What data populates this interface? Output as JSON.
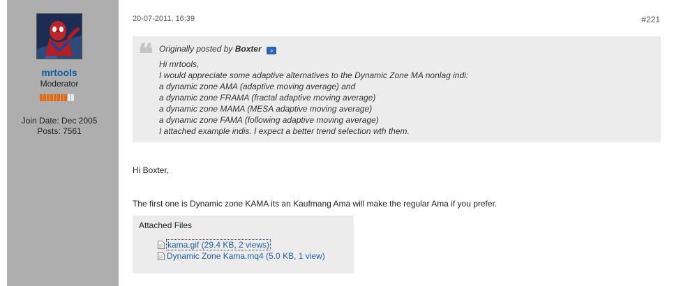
{
  "user": {
    "name": "mrtools",
    "title": "Moderator",
    "join_date": "Join Date: Dec 2005",
    "posts": "Posts: 7561",
    "reputation_level": 8,
    "reputation_max": 10,
    "colors": {
      "username": "#0d5fa8",
      "rep_on": "#e86a10",
      "sidebar": "#aeaeae"
    }
  },
  "post": {
    "date": "20-07-2011, 16:39",
    "number": "#221"
  },
  "quote": {
    "prefix": "Originally posted by",
    "author": "Boxter",
    "view_icon": "view-post-icon",
    "lines": [
      "Hi mrtools,",
      "I would appreciate some adaptive alternatives to the Dynamic Zone MA nonlag indi:",
      "a dynamic zone AMA (adaptive moving average) and",
      "a dynamic zone FRAMA (fractal adaptive moving average)",
      "a dynamic zone MAMA (MESA adaptive moving average)",
      "a dynamic zone FAMA (following adaptive moving average)",
      "I attached example indis. I expect a better trend selection wth them."
    ]
  },
  "message": {
    "greeting": "Hi Boxter,",
    "body": "The first one is Dynamic zone KAMA its an Kaufmang Ama will make the regular Ama if you prefer."
  },
  "attachments": {
    "title": "Attached Files",
    "files": [
      {
        "label": "kama.gif (29.4 KB, 2 views)",
        "icon": "file-icon"
      },
      {
        "label": "Dynamic Zone Kama.mq4 (5.0 KB, 1 view)",
        "icon": "file-icon"
      }
    ]
  }
}
